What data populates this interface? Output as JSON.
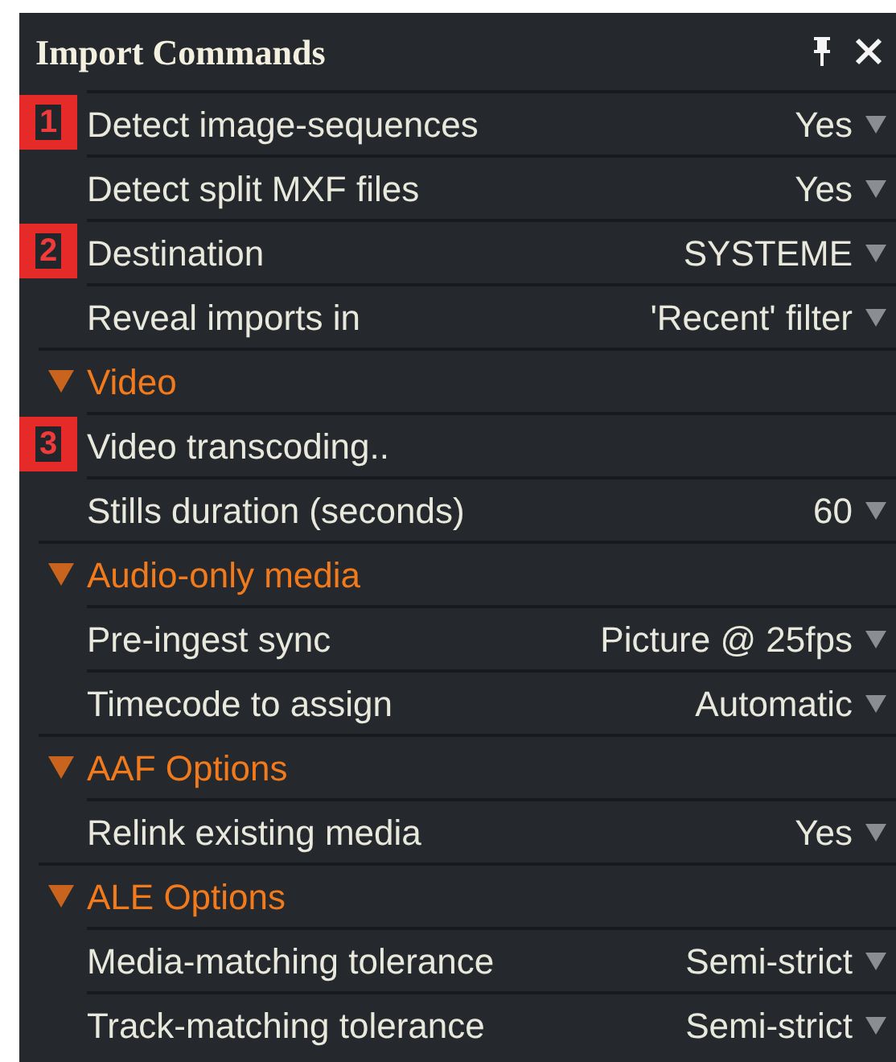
{
  "panel": {
    "title": "Import Commands"
  },
  "rows": [
    {
      "kind": "setting",
      "marker": "1",
      "label": "Detect image-sequences",
      "value": "Yes"
    },
    {
      "kind": "setting",
      "label": "Detect split MXF files",
      "value": "Yes"
    },
    {
      "kind": "setting",
      "marker": "2",
      "label": "Destination",
      "value": "SYSTEME"
    },
    {
      "kind": "setting",
      "label": "Reveal imports in",
      "value": "'Recent' filter"
    },
    {
      "kind": "section",
      "label": "Video",
      "expanded": true
    },
    {
      "kind": "action",
      "marker": "3",
      "label": "Video transcoding.."
    },
    {
      "kind": "setting",
      "label": "Stills duration (seconds)",
      "value": "60"
    },
    {
      "kind": "section",
      "label": "Audio-only media",
      "expanded": true
    },
    {
      "kind": "setting",
      "label": "Pre-ingest sync",
      "value": "Picture @ 25fps"
    },
    {
      "kind": "setting",
      "label": "Timecode to assign",
      "value": "Automatic"
    },
    {
      "kind": "section",
      "label": "AAF Options",
      "expanded": true
    },
    {
      "kind": "setting",
      "label": "Relink existing media",
      "value": "Yes"
    },
    {
      "kind": "section",
      "label": "ALE Options",
      "expanded": true
    },
    {
      "kind": "setting",
      "label": "Media-matching tolerance",
      "value": "Semi-strict"
    },
    {
      "kind": "setting",
      "label": "Track-matching tolerance",
      "value": "Semi-strict"
    }
  ]
}
